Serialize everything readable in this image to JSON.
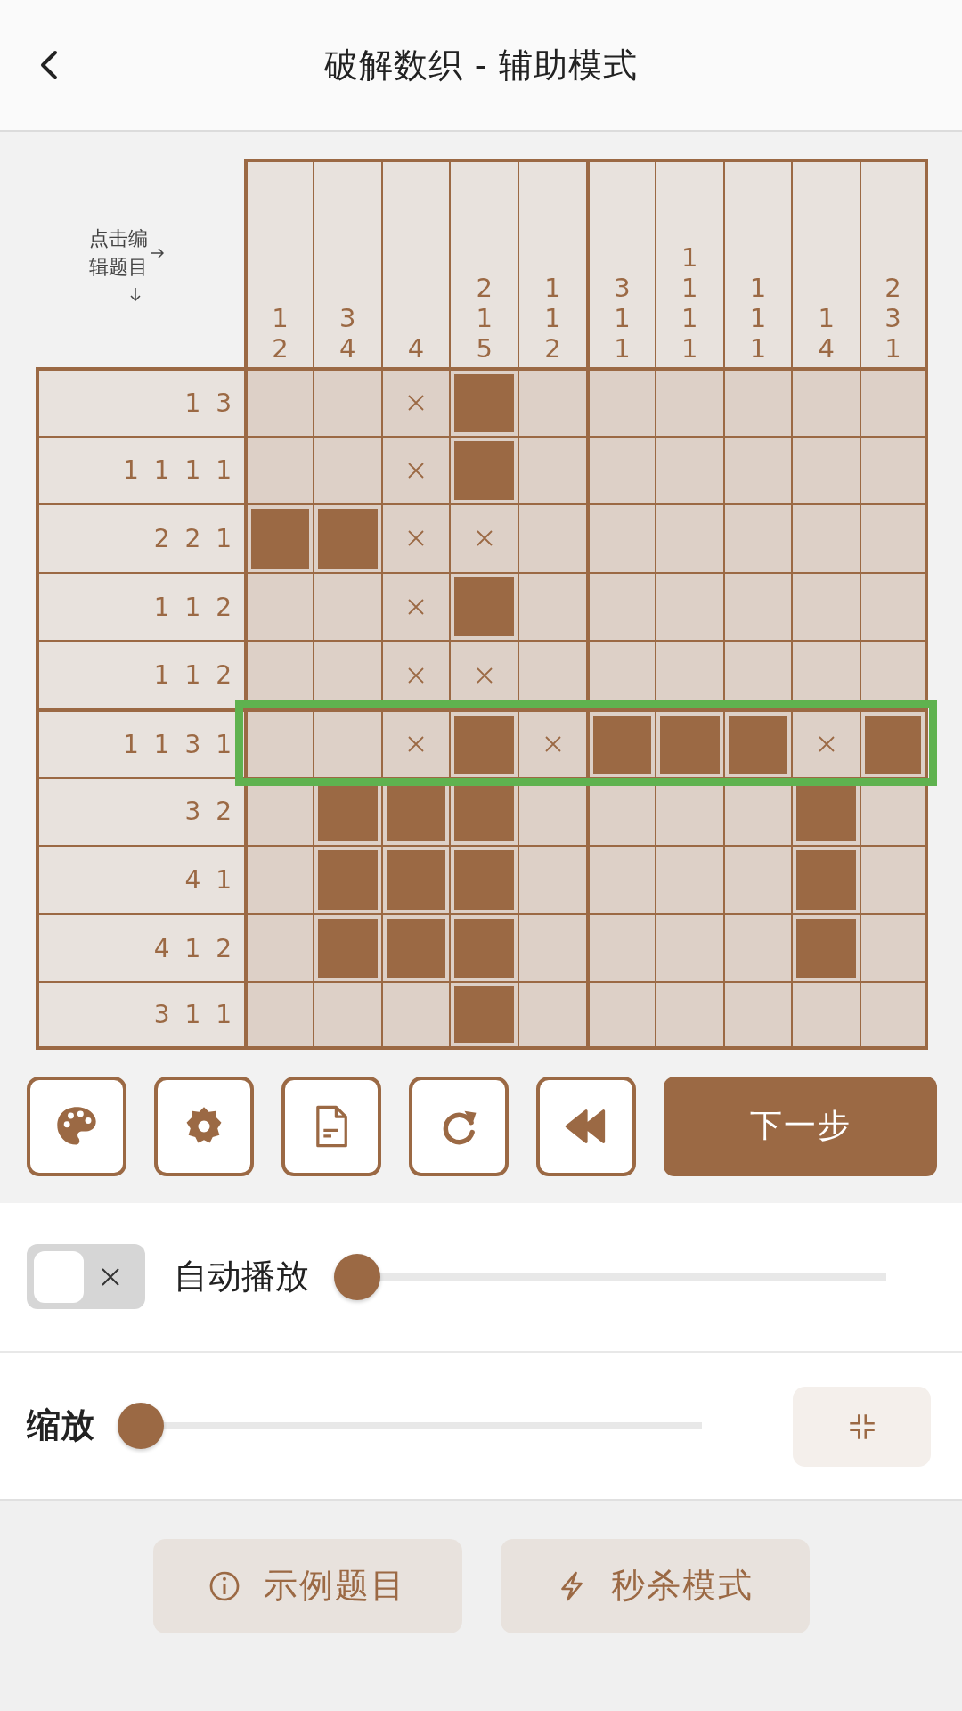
{
  "header": {
    "title": "破解数织 - 辅助模式"
  },
  "board": {
    "hint": "点击编辑题目",
    "column_clues": [
      [
        "1",
        "2"
      ],
      [
        "3",
        "4"
      ],
      [
        "4"
      ],
      [
        "2",
        "1",
        "5"
      ],
      [
        "1",
        "1",
        "2"
      ],
      [
        "3",
        "1",
        "1"
      ],
      [
        "1",
        "1",
        "1",
        "1"
      ],
      [
        "1",
        "1",
        "1"
      ],
      [
        "1",
        "4"
      ],
      [
        "2",
        "3",
        "1"
      ]
    ],
    "rows": [
      {
        "clue": "1 3",
        "highlighted": false,
        "cells": [
          {
            "filled": false,
            "crossed": false
          },
          {
            "filled": false,
            "crossed": false
          },
          {
            "filled": false,
            "crossed": true
          },
          {
            "filled": true,
            "crossed": false
          },
          {
            "filled": false,
            "crossed": false
          },
          {
            "filled": false,
            "crossed": false
          },
          {
            "filled": false,
            "crossed": false
          },
          {
            "filled": false,
            "crossed": false
          },
          {
            "filled": false,
            "crossed": false
          },
          {
            "filled": false,
            "crossed": false
          }
        ]
      },
      {
        "clue": "1 1 1 1",
        "highlighted": false,
        "cells": [
          {
            "filled": false,
            "crossed": false
          },
          {
            "filled": false,
            "crossed": false
          },
          {
            "filled": false,
            "crossed": true
          },
          {
            "filled": true,
            "crossed": false
          },
          {
            "filled": false,
            "crossed": false
          },
          {
            "filled": false,
            "crossed": false
          },
          {
            "filled": false,
            "crossed": false
          },
          {
            "filled": false,
            "crossed": false
          },
          {
            "filled": false,
            "crossed": false
          },
          {
            "filled": false,
            "crossed": false
          }
        ]
      },
      {
        "clue": "2 2 1",
        "highlighted": false,
        "cells": [
          {
            "filled": true,
            "crossed": false
          },
          {
            "filled": true,
            "crossed": false
          },
          {
            "filled": false,
            "crossed": true
          },
          {
            "filled": false,
            "crossed": true
          },
          {
            "filled": false,
            "crossed": false
          },
          {
            "filled": false,
            "crossed": false
          },
          {
            "filled": false,
            "crossed": false
          },
          {
            "filled": false,
            "crossed": false
          },
          {
            "filled": false,
            "crossed": false
          },
          {
            "filled": false,
            "crossed": false
          }
        ]
      },
      {
        "clue": "1 1 2",
        "highlighted": false,
        "cells": [
          {
            "filled": false,
            "crossed": false
          },
          {
            "filled": false,
            "crossed": false
          },
          {
            "filled": false,
            "crossed": true
          },
          {
            "filled": true,
            "crossed": false
          },
          {
            "filled": false,
            "crossed": false
          },
          {
            "filled": false,
            "crossed": false
          },
          {
            "filled": false,
            "crossed": false
          },
          {
            "filled": false,
            "crossed": false
          },
          {
            "filled": false,
            "crossed": false
          },
          {
            "filled": false,
            "crossed": false
          }
        ]
      },
      {
        "clue": "1 1 2",
        "highlighted": false,
        "cells": [
          {
            "filled": false,
            "crossed": false
          },
          {
            "filled": false,
            "crossed": false
          },
          {
            "filled": false,
            "crossed": true
          },
          {
            "filled": false,
            "crossed": true
          },
          {
            "filled": false,
            "crossed": false
          },
          {
            "filled": false,
            "crossed": false
          },
          {
            "filled": false,
            "crossed": false
          },
          {
            "filled": false,
            "crossed": false
          },
          {
            "filled": false,
            "crossed": false
          },
          {
            "filled": false,
            "crossed": false
          }
        ]
      },
      {
        "clue": "1 1 3 1",
        "highlighted": true,
        "cells": [
          {
            "filled": false,
            "crossed": false
          },
          {
            "filled": false,
            "crossed": false
          },
          {
            "filled": false,
            "crossed": true
          },
          {
            "filled": true,
            "crossed": false
          },
          {
            "filled": false,
            "crossed": true
          },
          {
            "filled": true,
            "crossed": false
          },
          {
            "filled": true,
            "crossed": false
          },
          {
            "filled": true,
            "crossed": false
          },
          {
            "filled": false,
            "crossed": true
          },
          {
            "filled": true,
            "crossed": false
          }
        ]
      },
      {
        "clue": "3 2",
        "highlighted": false,
        "cells": [
          {
            "filled": false,
            "crossed": false
          },
          {
            "filled": true,
            "crossed": false
          },
          {
            "filled": true,
            "crossed": false
          },
          {
            "filled": true,
            "crossed": false
          },
          {
            "filled": false,
            "crossed": false
          },
          {
            "filled": false,
            "crossed": false
          },
          {
            "filled": false,
            "crossed": false
          },
          {
            "filled": false,
            "crossed": false
          },
          {
            "filled": true,
            "crossed": false
          },
          {
            "filled": false,
            "crossed": false
          }
        ]
      },
      {
        "clue": "4 1",
        "highlighted": false,
        "cells": [
          {
            "filled": false,
            "crossed": false
          },
          {
            "filled": true,
            "crossed": false
          },
          {
            "filled": true,
            "crossed": false
          },
          {
            "filled": true,
            "crossed": false
          },
          {
            "filled": false,
            "crossed": false
          },
          {
            "filled": false,
            "crossed": false
          },
          {
            "filled": false,
            "crossed": false
          },
          {
            "filled": false,
            "crossed": false
          },
          {
            "filled": true,
            "crossed": false
          },
          {
            "filled": false,
            "crossed": false
          }
        ]
      },
      {
        "clue": "4 1 2",
        "highlighted": false,
        "cells": [
          {
            "filled": false,
            "crossed": false
          },
          {
            "filled": true,
            "crossed": false
          },
          {
            "filled": true,
            "crossed": false
          },
          {
            "filled": true,
            "crossed": false
          },
          {
            "filled": false,
            "crossed": false
          },
          {
            "filled": false,
            "crossed": false
          },
          {
            "filled": false,
            "crossed": false
          },
          {
            "filled": false,
            "crossed": false
          },
          {
            "filled": true,
            "crossed": false
          },
          {
            "filled": false,
            "crossed": false
          }
        ]
      },
      {
        "clue": "3 1 1",
        "highlighted": false,
        "cells": [
          {
            "filled": false,
            "crossed": false
          },
          {
            "filled": false,
            "crossed": false
          },
          {
            "filled": false,
            "crossed": false
          },
          {
            "filled": true,
            "crossed": false
          },
          {
            "filled": false,
            "crossed": false
          },
          {
            "filled": false,
            "crossed": false
          },
          {
            "filled": false,
            "crossed": false
          },
          {
            "filled": false,
            "crossed": false
          },
          {
            "filled": false,
            "crossed": false
          },
          {
            "filled": false,
            "crossed": false
          }
        ]
      }
    ]
  },
  "toolbar": {
    "tools": [
      {
        "kind": "palette"
      },
      {
        "kind": "settings"
      },
      {
        "kind": "document"
      },
      {
        "kind": "refresh"
      },
      {
        "kind": "rewind"
      }
    ],
    "next_button": "下一步"
  },
  "autoplay": {
    "on": false,
    "label": "自动播放",
    "level": 0
  },
  "zoom": {
    "label": "缩放",
    "level": 0
  },
  "bottom_buttons": [
    {
      "kind": "info",
      "label": "示例题目"
    },
    {
      "kind": "lightning",
      "label": "秒杀模式"
    }
  ]
}
